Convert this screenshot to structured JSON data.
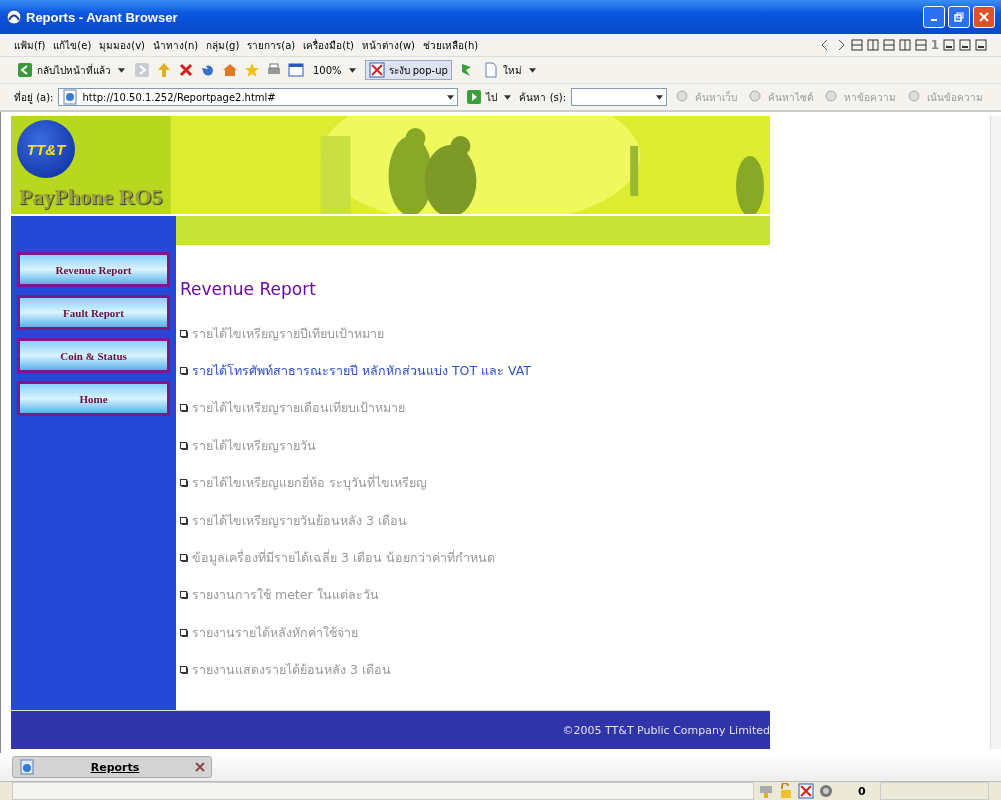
{
  "window": {
    "title": "Reports - Avant Browser"
  },
  "menu": [
    "แฟ้ม(f)",
    "แก้ไข(e)",
    "มุมมอง(v)",
    "นำทาง(n)",
    "กลุ่ม(g)",
    "รายการ(a)",
    "เครื่องมือ(t)",
    "หน้าต่าง(w)",
    "ช่วยเหลือ(h)"
  ],
  "menu_right": {
    "window_count": "1"
  },
  "toolbar": {
    "back": "กลับไปหน้าที่แล้ว",
    "zoom": "100%",
    "popup_block": "ระงับ pop-up",
    "new": "ใหม่"
  },
  "address_bar": {
    "label": "ที่อยู่ (a):",
    "url": "http://10.50.1.252/Reportpage2.html#",
    "go": "ไป",
    "search_label": "ค้นหา (s):",
    "search_buttons": [
      "ค้นหาเว็บ",
      "ค้นหาไซต์",
      "หาข้อความ",
      "เน้นข้อความ"
    ]
  },
  "page": {
    "logo": "TT&T",
    "site_name": "PayPhone RO5",
    "nav": [
      "Revenue Report",
      "Fault Report",
      "Coin & Status",
      "Home"
    ],
    "heading": "Revenue Report",
    "links": [
      {
        "text": "รายได้ไขเหรียญรายปีเทียบเป้าหมาย",
        "highlighted": false
      },
      {
        "text": "รายได้โทรศัพท์สาธารณะรายปี หลักหักส่วนแบ่ง TOT และ VAT",
        "highlighted": true
      },
      {
        "text": "รายได้ไขเหรียญรายเดือนเทียบเป้าหมาย",
        "highlighted": false
      },
      {
        "text": "รายได้ไขเหรียญรายวัน",
        "highlighted": false
      },
      {
        "text": "รายได้ไขเหรียญแยกยี่ห้อ ระบุวันที่ไขเหรียญ",
        "highlighted": false
      },
      {
        "text": "รายได้ไขเหรียญรายวันย้อนหลัง 3 เดือน",
        "highlighted": false
      },
      {
        "text": "ข้อมูลเครื่องที่มีรายได้เฉลี่ย 3 เดือน น้อยกว่าค่าที่กำหนด",
        "highlighted": false
      },
      {
        "text": "รายงานการใช้ meter ในแต่ละวัน",
        "highlighted": false
      },
      {
        "text": "รายงานรายได้หลังหักค่าใช้จ่าย",
        "highlighted": false
      },
      {
        "text": "รายงานแสดงรายได้ย้อนหลัง 3 เดือน",
        "highlighted": false
      }
    ],
    "footer": "©2005 TT&T Public Company Limited"
  },
  "tabs": [
    {
      "label": "Reports",
      "selected": true
    }
  ],
  "status_bar": {
    "count": "0"
  }
}
